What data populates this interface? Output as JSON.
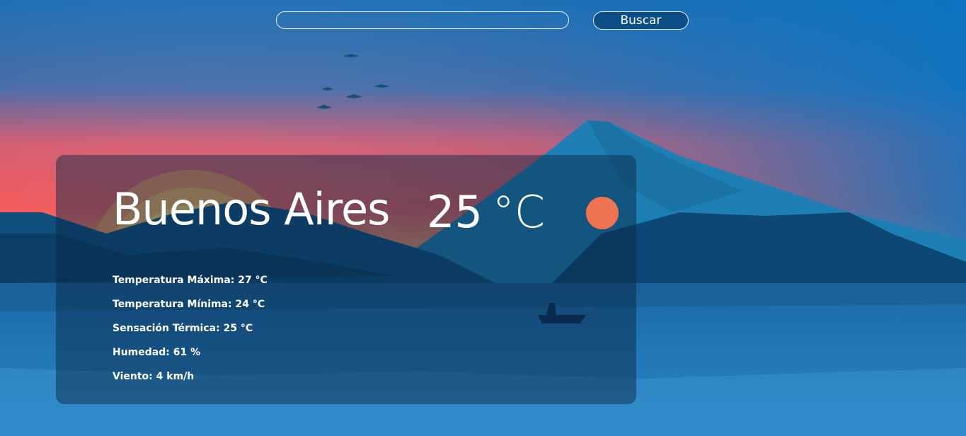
{
  "search": {
    "placeholder": "",
    "value": "",
    "button_label": "Buscar"
  },
  "weather": {
    "city": "Buenos Aires",
    "temperature": "25",
    "unit": "°C",
    "details": [
      {
        "label": "Temperatura Máxima:",
        "value": "27 °C"
      },
      {
        "label": "Temperatura Mínima:",
        "value": "24 °C"
      },
      {
        "label": "Sensación Térmica:",
        "value": "25 °C"
      },
      {
        "label": "Humedad:",
        "value": "61 %"
      },
      {
        "label": "Viento:",
        "value": "4 km/h"
      }
    ]
  },
  "icons": {
    "condition": "sun-icon"
  },
  "colors": {
    "sky_top": "#0a6fb9",
    "sunset_red": "#e85c5c",
    "sun": "#ef7551",
    "card": "#0a2848",
    "button": "#0c4f86"
  }
}
